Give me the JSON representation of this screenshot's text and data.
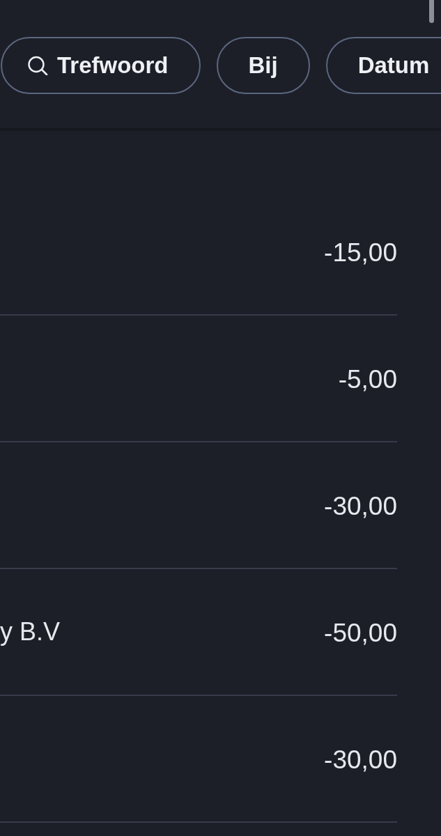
{
  "filters": [
    {
      "kind": "search",
      "label": "Trefwoord"
    },
    {
      "kind": "filter",
      "label": "Bij"
    },
    {
      "kind": "filter",
      "label": "Datum"
    }
  ],
  "transactions": [
    {
      "amount": "-15,00"
    },
    {
      "amount": "-5,00"
    },
    {
      "amount": "-30,00"
    },
    {
      "description": "y B.V",
      "amount": "-50,00"
    },
    {
      "amount": "-30,00"
    }
  ]
}
